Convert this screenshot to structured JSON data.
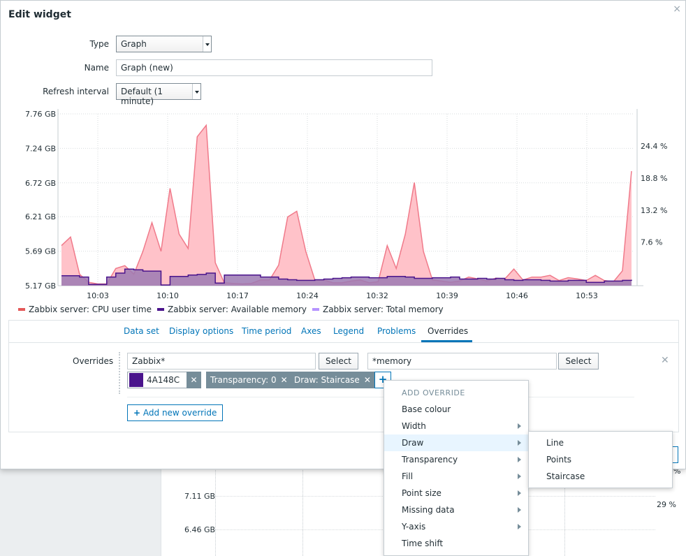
{
  "dialog": {
    "title": "Edit widget",
    "close_icon": "×"
  },
  "form": {
    "type_label": "Type",
    "type_value": "Graph",
    "name_label": "Name",
    "name_value": "Graph (new)",
    "refresh_label": "Refresh interval",
    "refresh_value": "Default (1 minute)"
  },
  "chart_data": {
    "type": "area",
    "x_ticks": [
      "10:03",
      "10:10",
      "10:17",
      "10:24",
      "10:32",
      "10:39",
      "10:46",
      "10:53"
    ],
    "y_left_ticks": [
      "7.76 GB",
      "7.24 GB",
      "6.72 GB",
      "6.21 GB",
      "5.69 GB",
      "5.17 GB"
    ],
    "y_right_ticks": [
      "24.4 %",
      "18.8 %",
      "13.2 %",
      "7.6 %"
    ],
    "series": [
      {
        "name": "Zabbix server: CPU user time",
        "color": "#e45959",
        "fill": "#ffc2c9",
        "axis": "right",
        "draw": "line",
        "values": [
          7,
          8.5,
          2,
          0.6,
          0.3,
          0.3,
          3,
          3.5,
          2,
          6,
          11,
          6,
          17,
          9,
          6.5,
          26,
          28,
          4,
          0.5,
          0.4,
          0.3,
          0.4,
          1,
          1,
          3.6,
          12,
          13,
          6,
          1,
          1,
          0.5,
          0.5,
          0.8,
          1,
          0.5,
          0.7,
          7,
          3,
          9,
          18,
          6,
          1,
          0.8,
          0.6,
          0.8,
          1.5,
          1.2,
          0.8,
          1.3,
          1.2,
          2.9,
          1,
          1.5,
          1.5,
          1.8,
          0.9,
          1.4,
          1.2,
          0.9,
          1.8,
          0.9,
          0.7,
          2.6,
          20
        ]
      },
      {
        "name": "Zabbix server: Available memory",
        "color": "#4a148c",
        "fill": "#9c7ab3",
        "axis": "left",
        "draw": "staircase",
        "values": [
          5.32,
          5.32,
          5.3,
          5.19,
          5.19,
          5.3,
          5.36,
          5.42,
          5.41,
          5.39,
          5.39,
          5.18,
          5.31,
          5.31,
          5.33,
          5.34,
          5.36,
          5.21,
          5.33,
          5.33,
          5.33,
          5.33,
          5.3,
          5.3,
          5.27,
          5.26,
          5.25,
          5.25,
          5.26,
          5.27,
          5.28,
          5.29,
          5.3,
          5.3,
          5.29,
          5.29,
          5.31,
          5.31,
          5.3,
          5.28,
          5.28,
          5.29,
          5.29,
          5.3,
          5.27,
          5.27,
          5.28,
          5.27,
          5.28,
          5.26,
          5.25,
          5.26,
          5.26,
          5.25,
          5.24,
          5.24,
          5.25,
          5.25,
          5.22,
          5.22,
          5.24,
          5.24,
          5.25,
          5.26
        ]
      },
      {
        "name": "Zabbix server: Total memory",
        "color": "#b694ff",
        "axis": "left",
        "draw": "line",
        "values": []
      }
    ]
  },
  "tabs": [
    "Data set",
    "Display options",
    "Time period",
    "Axes",
    "Legend",
    "Problems",
    "Overrides"
  ],
  "active_tab": "Overrides",
  "overrides": {
    "label": "Overrides",
    "host_pattern": "Zabbix*",
    "item_pattern": "*memory",
    "select_label": "Select",
    "color_value": "4A148C",
    "color_swatch": "#4a148c",
    "chip_transparency": "Transparency: 0",
    "chip_draw": "Draw: Staircase",
    "add_override_label": "Add new override",
    "plus_glyph": "+"
  },
  "menu": {
    "header": "ADD OVERRIDE",
    "items": [
      "Base colour",
      "Width",
      "Draw",
      "Transparency",
      "Fill",
      "Point size",
      "Missing data",
      "Y-axis",
      "Time shift"
    ],
    "hovered": "Draw",
    "submenu": [
      "Line",
      "Points",
      "Staircase"
    ]
  },
  "background": {
    "y_ticks": [
      "7.11 GB",
      "6.46 GB"
    ],
    "right_tick": "29 %",
    "right_tick2": "%"
  }
}
